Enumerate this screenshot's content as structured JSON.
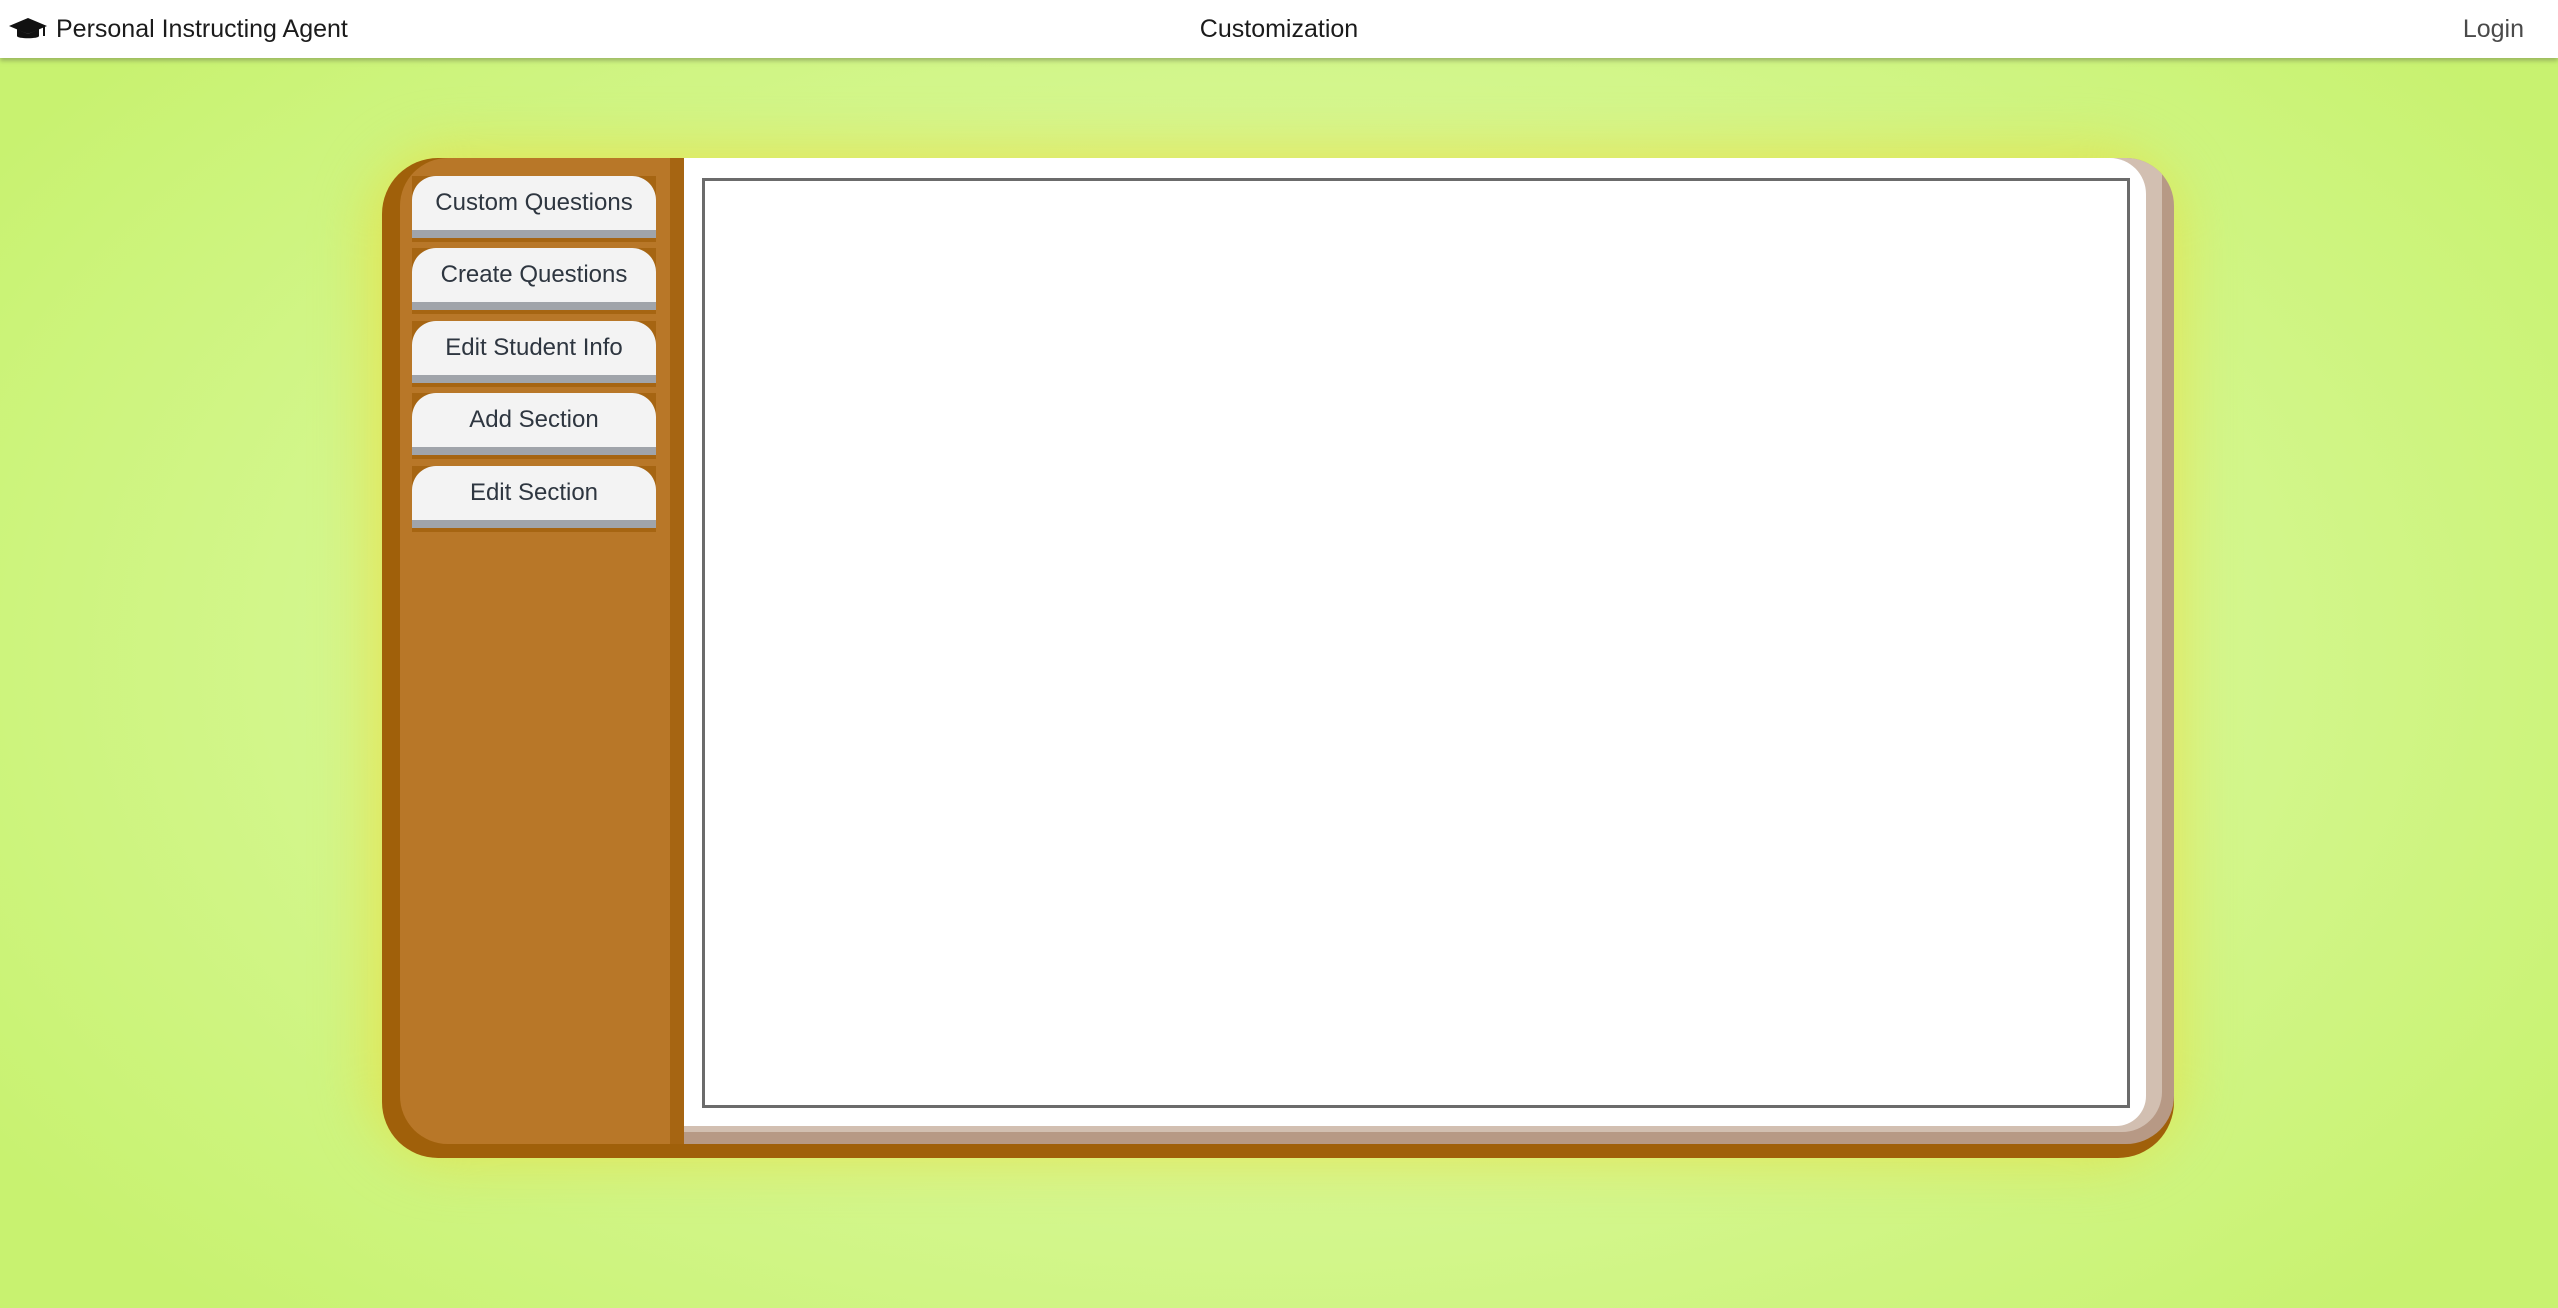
{
  "header": {
    "brand_icon": "graduation-cap-icon",
    "brand_name": "Personal Instructing Agent",
    "page_title": "Customization",
    "login_label": "Login"
  },
  "sidebar": {
    "tabs": [
      {
        "label": "Custom Questions"
      },
      {
        "label": "Create Questions"
      },
      {
        "label": "Edit Student Info"
      },
      {
        "label": "Add Section"
      },
      {
        "label": "Edit Section"
      }
    ]
  },
  "colors": {
    "background": "#d8f89a",
    "book_cover": "#a0600a",
    "sidebar": "#b87728",
    "tab_face": "#f3f3f3",
    "tab_underline": "#a0a4aa"
  }
}
